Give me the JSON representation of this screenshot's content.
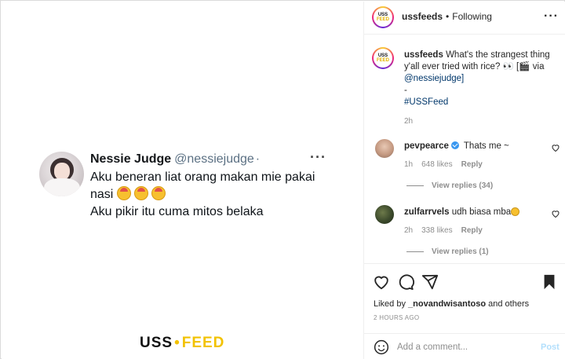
{
  "left_panel": {
    "tweet": {
      "name": "Nessie Judge",
      "handle": "@nessiejudge",
      "dot": "·",
      "more": "···",
      "line1": "Aku beneran liat orang makan mie pakai nasi",
      "line2": "Aku pikir itu cuma mitos belaka"
    },
    "brand": {
      "uss": "USS",
      "sep": "•",
      "feed": "FEED"
    }
  },
  "post": {
    "account_logo_top": "USS",
    "account_logo_bottom": "FEED",
    "header": {
      "username": "ussfeeds",
      "separator": "•",
      "follow_status": "Following",
      "more": "···"
    },
    "caption": {
      "username": "ussfeeds",
      "text": "What's the strangest thing y'all ever tried with rice? 👀 [🎬 via",
      "mention": "@nessiejudge]",
      "dash": "-",
      "hashtag": "#USSFeed",
      "time": "2h"
    },
    "comments": [
      {
        "username": "pevpearce",
        "text": "Thats me ~",
        "time": "1h",
        "likes": "648 likes",
        "reply": "Reply",
        "view_replies": "View replies (34)"
      },
      {
        "username": "zulfarrvels",
        "text": "udh biasa mba",
        "time": "2h",
        "likes": "338 likes",
        "reply": "Reply",
        "view_replies": "View replies (1)"
      }
    ],
    "liked_by": {
      "prefix": "Liked by",
      "user": "_novandwisantoso",
      "suffix": "and others"
    },
    "posted_ago": "2 HOURS AGO",
    "add_comment": {
      "placeholder": "Add a comment...",
      "post_label": "Post"
    }
  }
}
